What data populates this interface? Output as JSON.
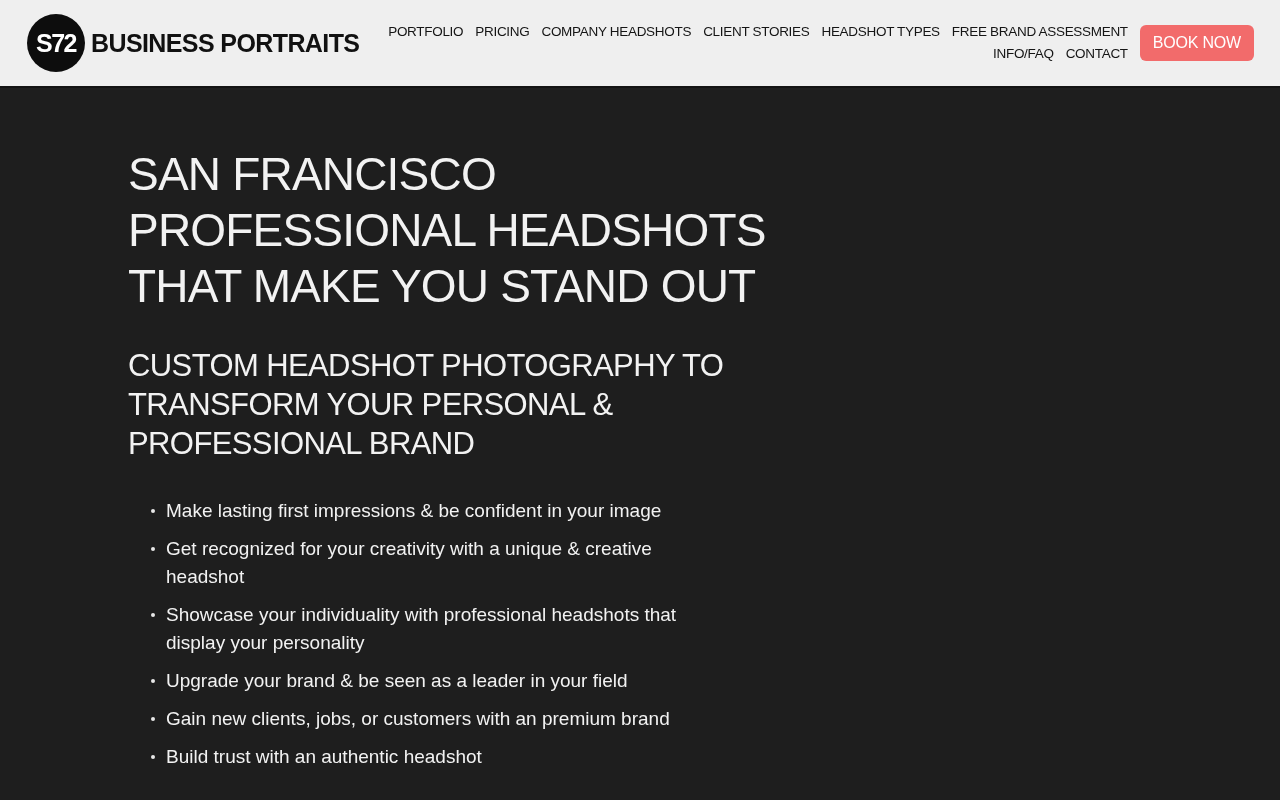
{
  "header": {
    "logo": {
      "mark": "S72",
      "name": "BUSINESS PORTRAITS"
    },
    "nav": [
      {
        "label": "PORTFOLIO"
      },
      {
        "label": "PRICING"
      },
      {
        "label": "COMPANY HEADSHOTS"
      },
      {
        "label": "CLIENT STORIES"
      },
      {
        "label": "HEADSHOT TYPES"
      },
      {
        "label": "FREE BRAND ASSESSMENT"
      },
      {
        "label": "INFO/FAQ"
      },
      {
        "label": "CONTACT"
      }
    ],
    "cta": "BOOK NOW"
  },
  "hero": {
    "title": "SAN FRANCISCO PROFESSIONAL HEADSHOTS THAT MAKE YOU STAND OUT",
    "subtitle": "CUSTOM HEADSHOT PHOTOGRAPHY TO TRANSFORM YOUR PERSONAL & PROFESSIONAL BRAND",
    "benefits": [
      "Make lasting first impressions & be confident in your image",
      "Get recognized for your creativity with a unique & creative headshot",
      "Showcase your individuality with professional headshots that display your personality",
      "Upgrade your brand & be seen as a leader in your field",
      "Gain new clients, jobs, or customers with an premium brand",
      "Build trust with an authentic headshot"
    ]
  }
}
